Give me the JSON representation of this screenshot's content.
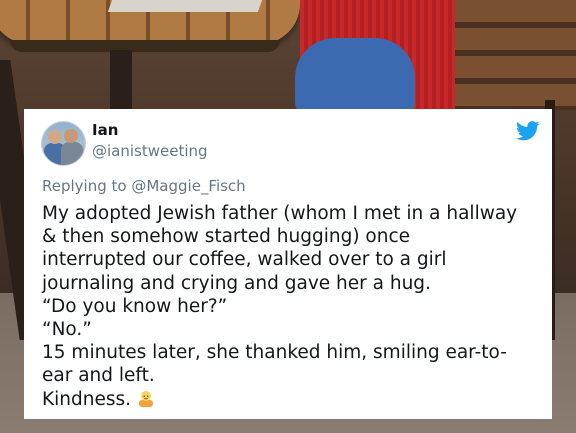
{
  "tweet": {
    "author_name": "Ian",
    "author_handle": "@ianistweeting",
    "reply_prefix": "Replying to ",
    "reply_to": "@Maggie_Fisch",
    "lines": [
      "My adopted Jewish father (whom I met in a hallway",
      "& then somehow started hugging) once",
      "interrupted our coffee, walked over to a girl",
      "journaling and crying and gave her a hug.",
      "“Do you know her?”",
      "“No.”",
      "15 minutes later, she thanked him, smiling ear-to-",
      "ear and left.",
      "Kindness."
    ],
    "trailing_emoji": "person-emoji",
    "brand_icon": "twitter-bird-icon",
    "brand_color": "#1DA1F2"
  }
}
